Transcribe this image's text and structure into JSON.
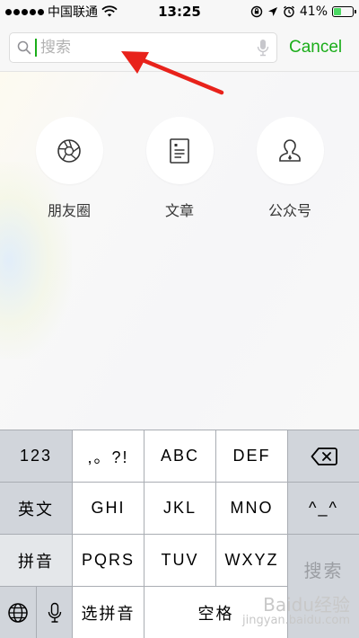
{
  "status_bar": {
    "carrier": "中国联通",
    "time": "13:25",
    "battery": "41%",
    "battery_level": 0.41
  },
  "search": {
    "placeholder": "搜索",
    "cancel_label": "Cancel"
  },
  "categories": [
    {
      "label": "朋友圈",
      "icon": "aperture-icon"
    },
    {
      "label": "文章",
      "icon": "article-icon"
    },
    {
      "label": "公众号",
      "icon": "official-account-icon"
    }
  ],
  "keyboard": {
    "row1": [
      "123",
      ",。?!",
      "ABC",
      "DEF"
    ],
    "row2": [
      "英文",
      "GHI",
      "JKL",
      "MNO",
      "^_^"
    ],
    "row3": [
      "拼音",
      "PQRS",
      "TUV",
      "WXYZ"
    ],
    "row4": [
      "选拼音",
      "空格"
    ],
    "action_label": "搜索",
    "delete_icon": "backspace-icon"
  },
  "watermark": {
    "title": "Baidu经验",
    "url": "jingyan.baidu.com"
  },
  "colors": {
    "accent": "#1aad19",
    "arrow": "#e8221b",
    "keyboard_bg": "#d1d5db"
  }
}
